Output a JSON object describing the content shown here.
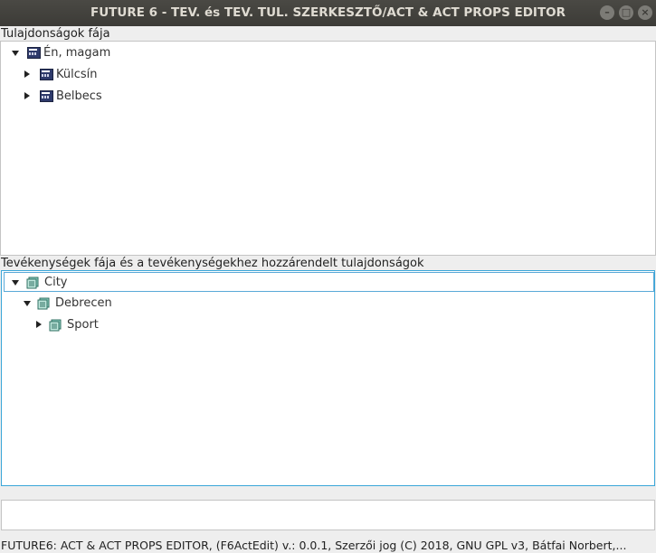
{
  "window": {
    "title": "FUTURE 6 - TEV. és TEV. TUL. SZERKESZTŐ/ACT & ACT PROPS EDITOR",
    "minimize_glyph": "–",
    "maximize_glyph": "□",
    "close_glyph": "×"
  },
  "props_tree": {
    "label": "Tulajdonságok fája",
    "items": [
      {
        "label": "Én, magam",
        "expanded": true,
        "icon": "property-icon"
      },
      {
        "label": "Külcsín",
        "expanded": false,
        "icon": "property-icon"
      },
      {
        "label": "Belbecs",
        "expanded": false,
        "icon": "property-icon"
      }
    ]
  },
  "acts_tree": {
    "label": "Tevékenységek fája és a tevékenységekhez hozzárendelt tulajdonságok",
    "items": [
      {
        "label": "City",
        "expanded": true,
        "selected": true,
        "icon": "activity-icon"
      },
      {
        "label": "Debrecen",
        "expanded": true,
        "icon": "activity-icon"
      },
      {
        "label": "Sport",
        "expanded": false,
        "icon": "activity-icon"
      }
    ]
  },
  "status_field": {
    "value": ""
  },
  "footer": {
    "text": "FUTURE6: ACT & ACT PROPS EDITOR, (F6ActEdit) v.: 0.0.1, Szerzői jog (C) 2018, GNU GPL v3, Bátfai Norbert,..."
  },
  "colors": {
    "titlebar": "#3c3b37",
    "focus_border": "#3aa6d8",
    "activity_icon": "#4c9a8a",
    "property_icon": "#2e3a6b"
  }
}
